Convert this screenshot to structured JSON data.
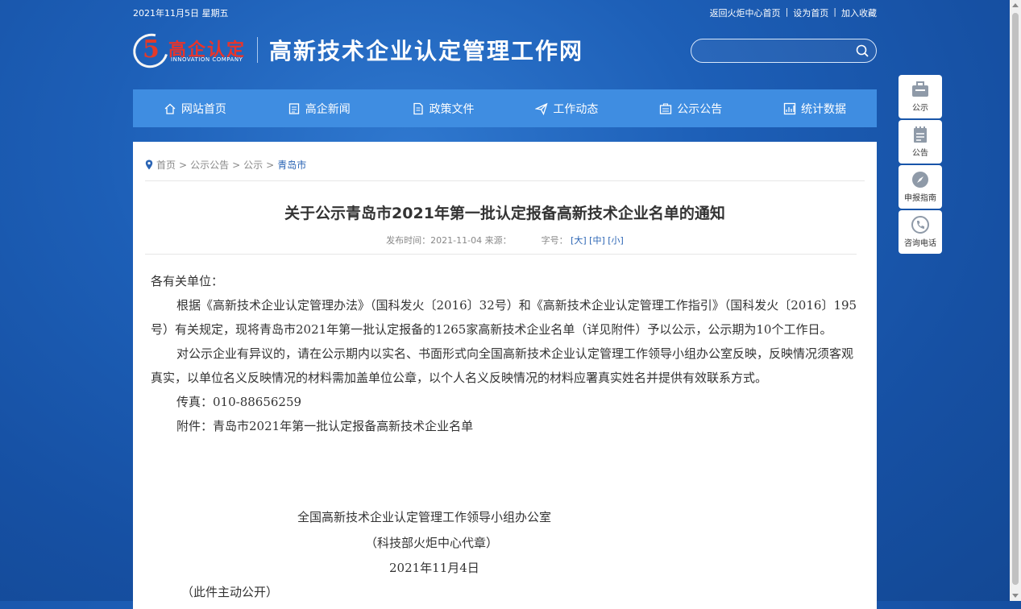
{
  "topbar": {
    "date": "2021年11月5日 星期五",
    "links": [
      "返回火炬中心首页",
      "设为首页",
      "加入收藏"
    ]
  },
  "logo": {
    "cn": "高企认定",
    "en": "INNOVATION COMPANY"
  },
  "site_title": "高新技术企业认定管理工作网",
  "search": {
    "placeholder": ""
  },
  "nav": [
    {
      "label": "网站首页",
      "icon": "home-icon"
    },
    {
      "label": "高企新闻",
      "icon": "news-icon"
    },
    {
      "label": "政策文件",
      "icon": "document-icon"
    },
    {
      "label": "工作动态",
      "icon": "send-icon"
    },
    {
      "label": "公示公告",
      "icon": "notice-icon"
    },
    {
      "label": "统计数据",
      "icon": "chart-icon"
    }
  ],
  "breadcrumb": {
    "items": [
      "首页",
      "公示公告",
      "公示"
    ],
    "current": "青岛市",
    "sep": ">"
  },
  "article": {
    "title": "关于公示青岛市2021年第一批认定报备高新技术企业名单的通知",
    "meta_publish": "发布时间：2021-11-04 来源：",
    "meta_fontsize": "字号：",
    "font_sizes": [
      "[大]",
      "[中]",
      "[小]"
    ],
    "greeting": "各有关单位：",
    "para1": "根据《高新技术企业认定管理办法》（国科发火〔2016〕32号）和《高新技术企业认定管理工作指引》（国科发火〔2016〕195号）有关规定，现将青岛市2021年第一批认定报备的1265家高新技术企业名单（详见附件）予以公示，公示期为10个工作日。",
    "para2": "对公示企业有异议的，请在公示期内以实名、书面形式向全国高新技术企业认定管理工作领导小组办公室反映，反映情况须客观真实，以单位名义反映情况的材料需加盖单位公章，以个人名义反映情况的材料应署真实姓名并提供有效联系方式。",
    "fax": "传真：010-88656259",
    "attachment": "附件：青岛市2021年第一批认定报备高新技术企业名单",
    "sign_org": "全国高新技术企业认定管理工作领导小组办公室",
    "sign_sub": "（科技部火炬中心代章）",
    "sign_date": "2021年11月4日",
    "note": "（此件主动公开）"
  },
  "side_tools": [
    {
      "label": "公示",
      "icon": "briefcase-icon"
    },
    {
      "label": "公告",
      "icon": "notepad-icon"
    },
    {
      "label": "申报指南",
      "icon": "compass-icon"
    },
    {
      "label": "咨询电话",
      "icon": "phone-icon"
    }
  ]
}
